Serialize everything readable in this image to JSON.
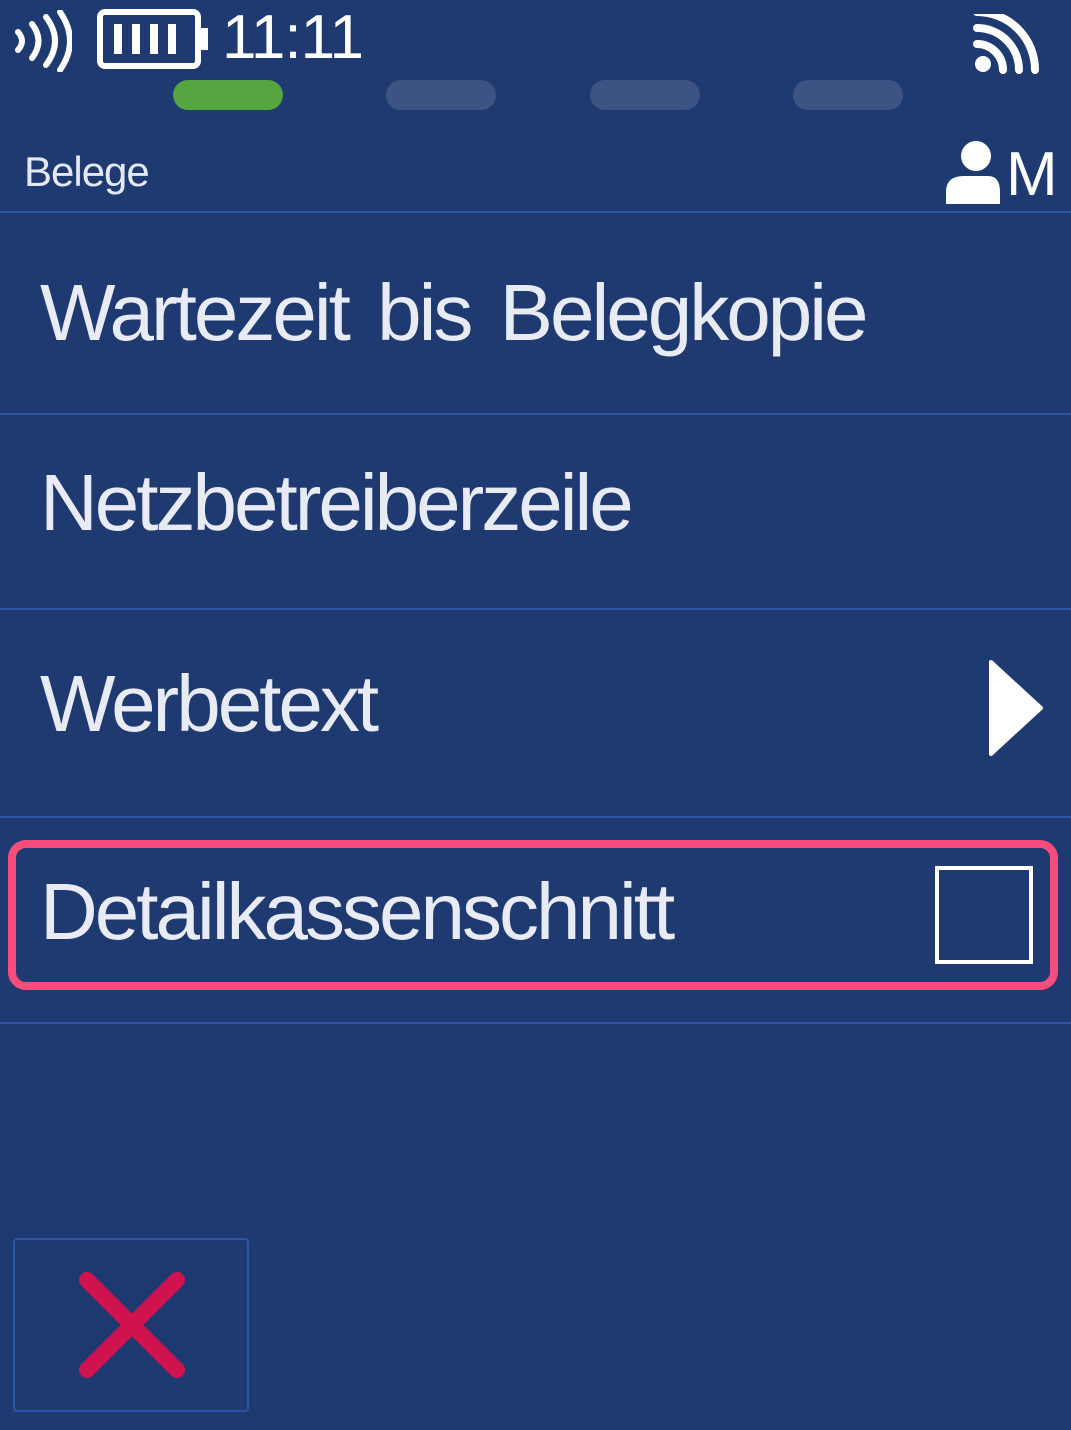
{
  "status_bar": {
    "time": "11:11",
    "nfc_icon": "contactless-icon",
    "battery_icon": "battery-full-icon",
    "signal_icon": "wifi-signal-icon"
  },
  "steps": {
    "total": 4,
    "active_index": 0,
    "active_color": "#55a641",
    "inactive_color": "#3c5383"
  },
  "header": {
    "title": "Belege",
    "user_icon": "user-icon",
    "user_level": "M"
  },
  "menu": {
    "items": [
      {
        "label": "Wartezeit bis Belegkopie"
      },
      {
        "label": "Netzbetreiberzeile"
      },
      {
        "label": "Werbetext",
        "icon": "chevron-right-icon"
      },
      {
        "label": "Detailkassenschnitt",
        "control": "checkbox",
        "checked": false,
        "highlighted": true
      }
    ]
  },
  "footer": {
    "cancel_icon": "close-icon",
    "cancel_color": "#d0134f"
  },
  "colors": {
    "background": "#1e3a70",
    "divider": "#2c56a0",
    "highlight": "#f64d7d"
  }
}
